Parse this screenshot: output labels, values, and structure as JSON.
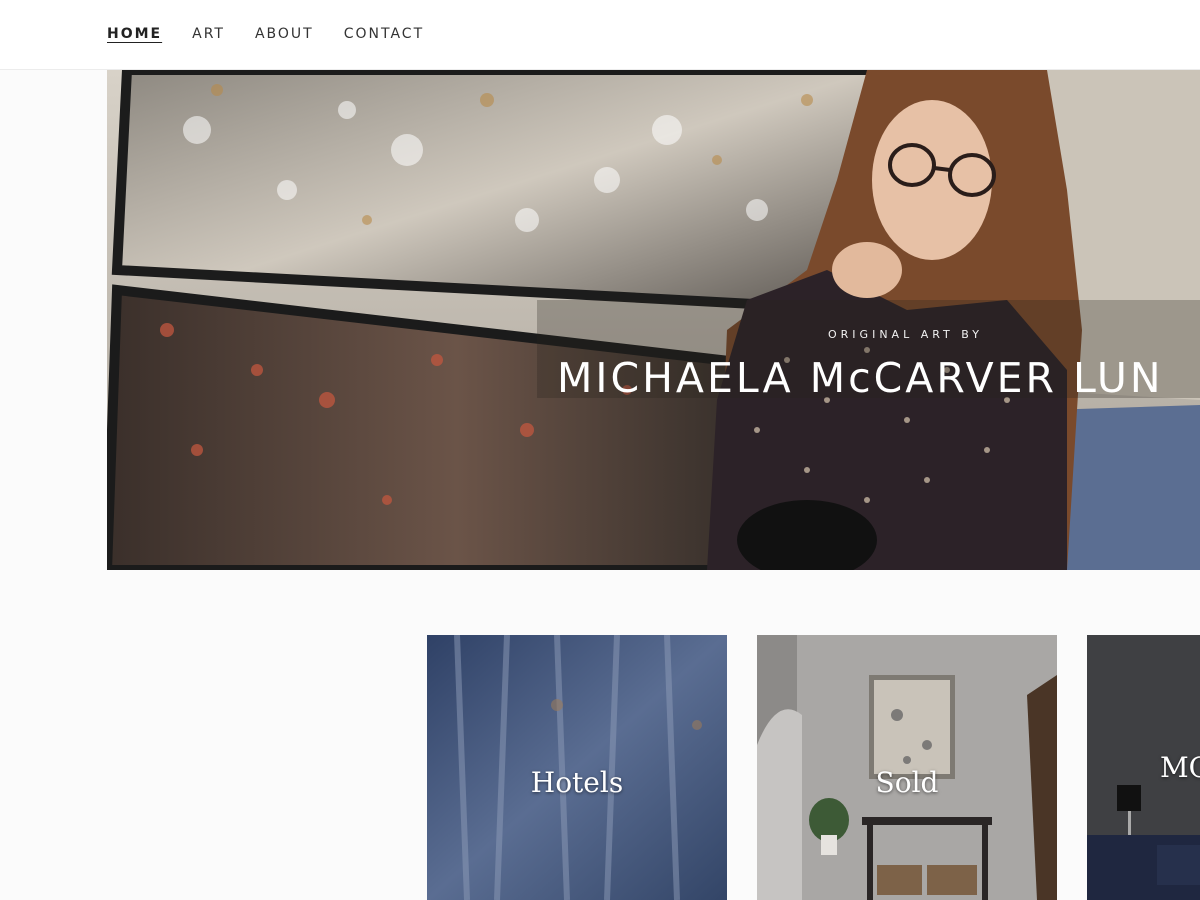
{
  "nav": {
    "items": [
      {
        "label": "HOME",
        "active": true
      },
      {
        "label": "ART",
        "active": false
      },
      {
        "label": "ABOUT",
        "active": false
      },
      {
        "label": "CONTACT",
        "active": false
      }
    ]
  },
  "hero": {
    "kicker": "ORIGINAL ART BY",
    "title": "MICHAELA McCARVER LUN"
  },
  "tiles": [
    {
      "label": "Hotels"
    },
    {
      "label": "Sold"
    },
    {
      "label": "MC"
    }
  ]
}
